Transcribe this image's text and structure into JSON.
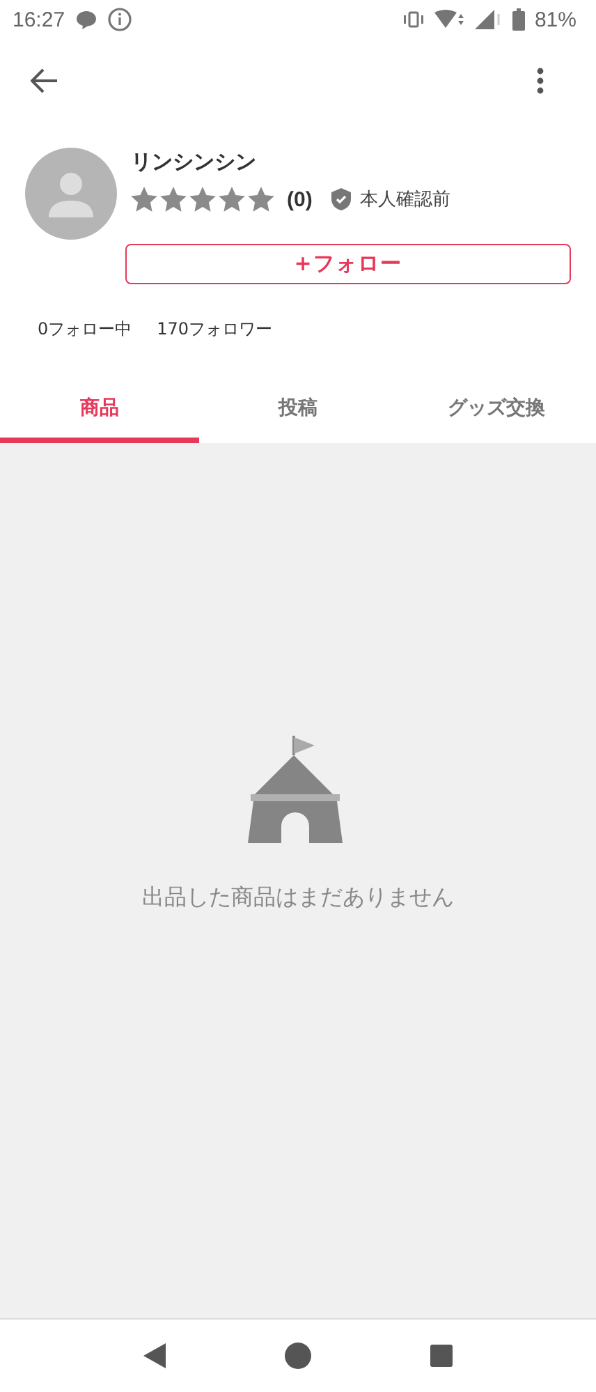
{
  "status_bar": {
    "time": "16:27",
    "battery": "81%"
  },
  "profile": {
    "name": "リンシンシン",
    "review_count": "(0)",
    "verification": "本人確認前",
    "follow_button": "+フォロー",
    "following": "0フォロー中",
    "followers": "170フォロワー"
  },
  "tabs": [
    {
      "label": "商品",
      "selected": true
    },
    {
      "label": "投稿",
      "selected": false
    },
    {
      "label": "グッズ交換",
      "selected": false
    }
  ],
  "empty_message": "出品した商品はまだありません"
}
